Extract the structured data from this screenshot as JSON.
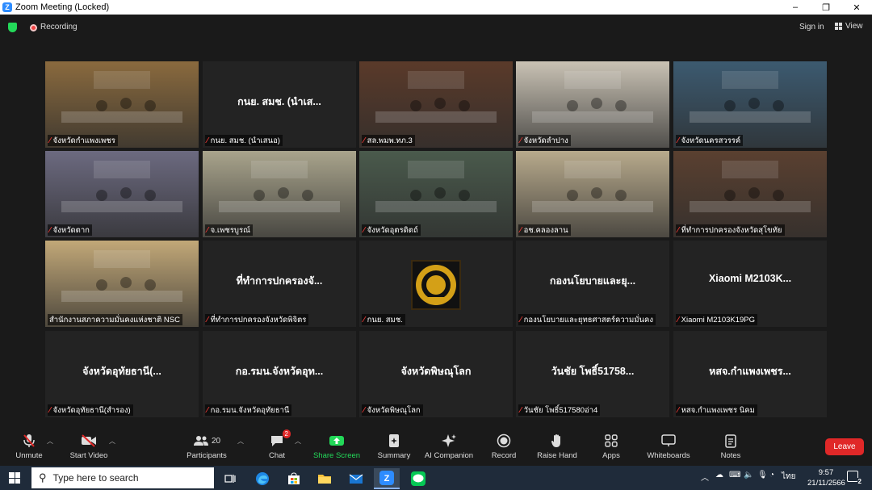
{
  "window": {
    "title": "Zoom Meeting (Locked)",
    "controls": [
      "–",
      "❐",
      "✕"
    ]
  },
  "topbar": {
    "recording_label": "Recording",
    "sign_in_label": "Sign in",
    "view_label": "View"
  },
  "tiles": [
    {
      "name": "จังหวัดกำแพงเพชร",
      "center": "",
      "video": true,
      "muted": true
    },
    {
      "name": "กนย. สมช. (นำเสนอ)",
      "center": "กนย. สมช. (นำเส...",
      "video": false,
      "muted": true
    },
    {
      "name": "สล.พมพ.ทภ.3",
      "center": "",
      "video": true,
      "muted": true
    },
    {
      "name": "จังหวัดลำปาง",
      "center": "",
      "video": true,
      "muted": true
    },
    {
      "name": "จังหวัดนครสวรรค์",
      "center": "",
      "video": true,
      "muted": true
    },
    {
      "name": "จังหวัดตาก",
      "center": "",
      "video": true,
      "muted": true
    },
    {
      "name": "จ.เพชรบูรณ์",
      "center": "",
      "video": true,
      "muted": true
    },
    {
      "name": "จังหวัดอุตรดิตถ์",
      "center": "",
      "video": true,
      "muted": true
    },
    {
      "name": "อช.คลองลาน",
      "center": "",
      "video": true,
      "muted": true
    },
    {
      "name": "ที่ทำการปกครองจังหวัดสุโขทัย",
      "center": "",
      "video": true,
      "muted": true
    },
    {
      "name": "สำนักงานสภาความมั่นคงแห่งชาติ NSC",
      "center": "",
      "video": true,
      "muted": false,
      "active": true
    },
    {
      "name": "ที่ทำการปกครองจังหวัดพิจิตร",
      "center": "ที่ทำการปกครองจั...",
      "video": false,
      "muted": true
    },
    {
      "name": "กนย. สมช.",
      "center": "",
      "video": false,
      "muted": true,
      "logo": true
    },
    {
      "name": "กองนโยบายและยุทธศาสตร์ความมั่นคง",
      "center": "กองนโยบายและยุ...",
      "video": false,
      "muted": true
    },
    {
      "name": "Xiaomi M2103K19PG",
      "center": "Xiaomi  M2103K...",
      "video": false,
      "muted": true
    },
    {
      "name": "จังหวัดอุทัยธานี(สำรอง)",
      "center": "จังหวัดอุทัยธานี(...",
      "video": false,
      "muted": true
    },
    {
      "name": "กอ.รมน.จังหวัดอุทัยธานี",
      "center": "กอ.รมน.จังหวัดอุท...",
      "video": false,
      "muted": true
    },
    {
      "name": "จังหวัดพิษณุโลก",
      "center": "จังหวัดพิษณุโลก",
      "video": false,
      "muted": true
    },
    {
      "name": "วันชัย โพธิ์517580อ่า4",
      "center": "วันชัย  โพธิ์51758...",
      "video": false,
      "muted": true
    },
    {
      "name": "หสจ.กำแพงเพชร นิคม",
      "center": "หสจ.กำแพงเพชร...",
      "video": false,
      "muted": true
    }
  ],
  "tile_images": [
    "#8a6a3e",
    "#3a3a3a",
    "#5a3a2a",
    "#c9c2b4",
    "#3c5a70",
    "#6c6a80",
    "#a9a48c",
    "#4a5a4c",
    "#b8aa8c",
    "#5a4030",
    "#c2a878"
  ],
  "toolbar": {
    "unmute": "Unmute",
    "start_video": "Start Video",
    "participants": "Participants",
    "participants_count": "20",
    "chat": "Chat",
    "chat_badge": "2",
    "share_screen": "Share Screen",
    "summary": "Summary",
    "ai_companion": "AI Companion",
    "record": "Record",
    "raise_hand": "Raise Hand",
    "apps": "Apps",
    "whiteboards": "Whiteboards",
    "notes": "Notes",
    "leave": "Leave"
  },
  "taskbar": {
    "search_placeholder": "Type here to search",
    "time": "9:57",
    "date": "21/11/2566",
    "language": "ไทย",
    "notification_count": "2"
  },
  "colors": {
    "accent_blue": "#2d8cff",
    "share_green": "#23d959",
    "leave_red": "#e02828",
    "active_speaker": "#d6de25"
  }
}
